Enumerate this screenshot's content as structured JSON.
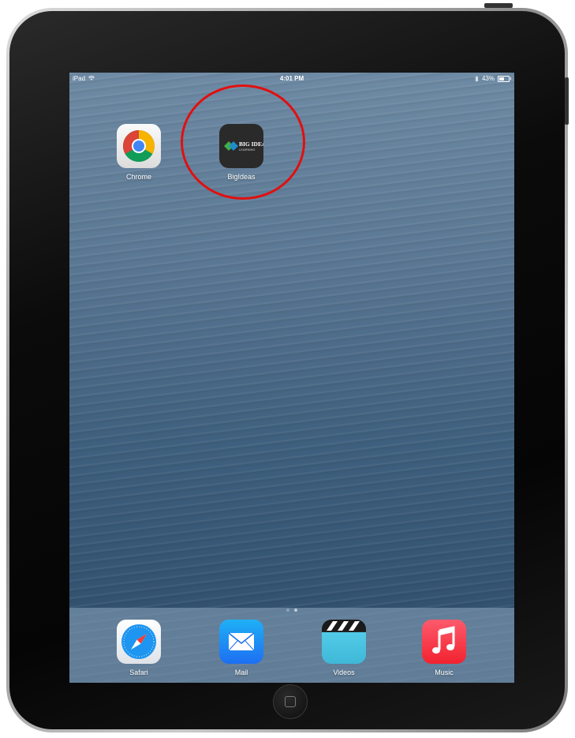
{
  "status_bar": {
    "device": "iPad",
    "wifi_icon": "wifi-icon",
    "time": "4:01 PM",
    "bluetooth_icon": "bluetooth-icon",
    "battery": "43%"
  },
  "home_apps": [
    {
      "label": "Chrome",
      "icon": "chrome-icon"
    },
    {
      "label": "BigIdeas",
      "icon": "bigideas-icon",
      "icon_text": "BIG IDEAS",
      "icon_subtext": "LEARNING",
      "highlighted": true
    }
  ],
  "page_indicator": {
    "pages": 2,
    "current": 2
  },
  "dock_apps": [
    {
      "label": "Safari",
      "icon": "safari-icon"
    },
    {
      "label": "Mail",
      "icon": "mail-icon"
    },
    {
      "label": "Videos",
      "icon": "videos-icon"
    },
    {
      "label": "Music",
      "icon": "music-icon"
    }
  ],
  "colors": {
    "highlight": "#e01010",
    "wallpaper": "#3f607e"
  }
}
